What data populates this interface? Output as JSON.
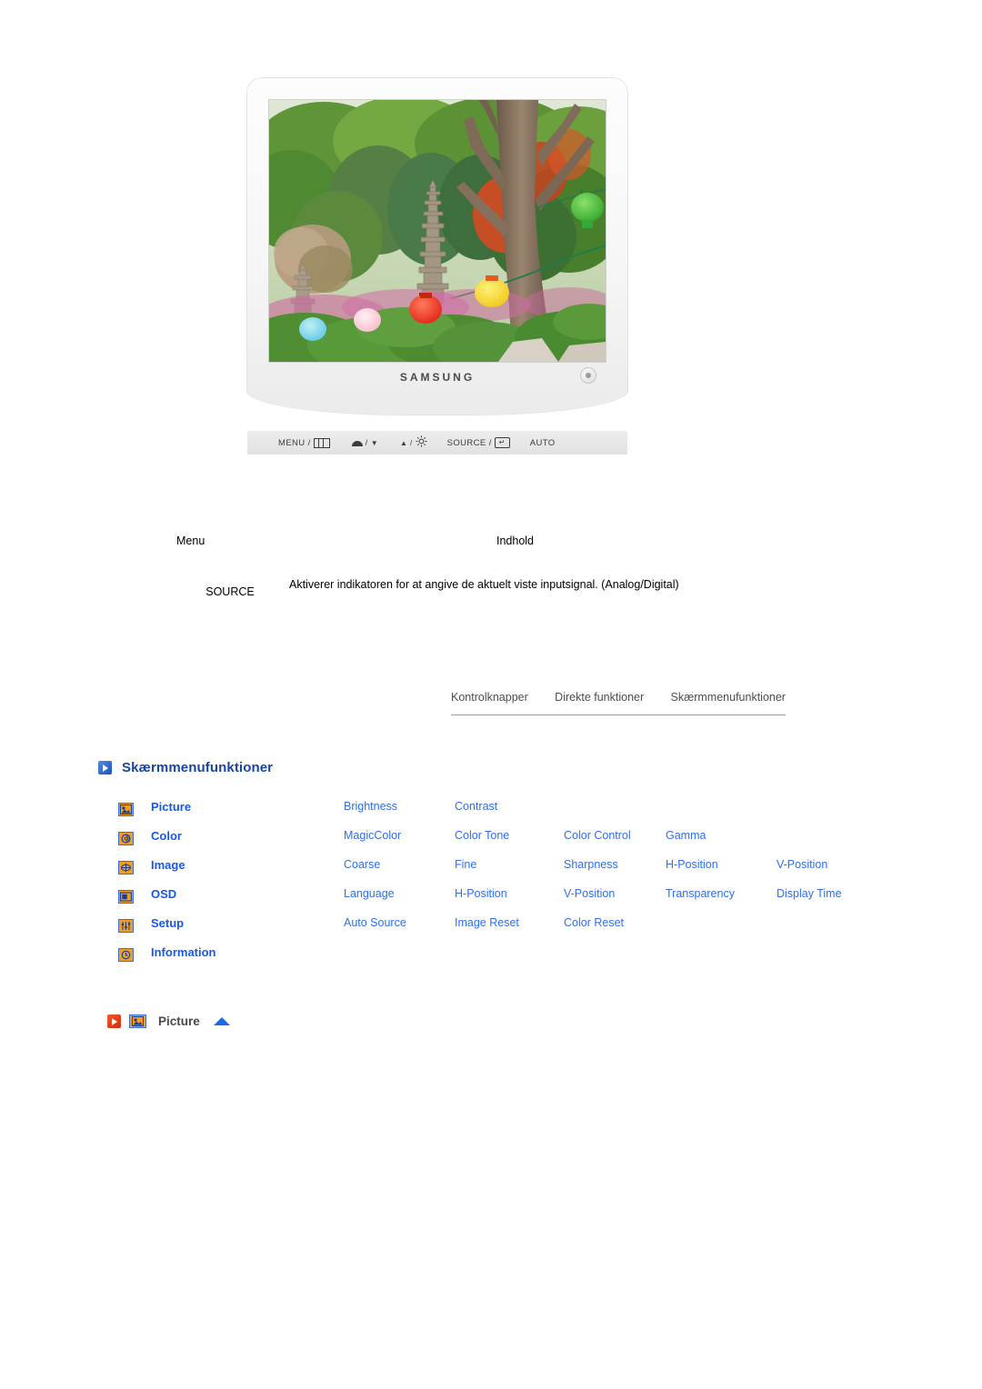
{
  "monitor": {
    "brand": "SAMSUNG",
    "power_button": "power-button",
    "screen_alt": "Korean garden with stone pagoda and paper lanterns"
  },
  "control_bar": {
    "keys": [
      {
        "label": "MENU /",
        "glyph": "menu-grid-icon"
      },
      {
        "label": "/",
        "glyph": "contrast-icon",
        "suffix": "▼"
      },
      {
        "label": "▲ /",
        "glyph": "brightness-sun-icon"
      },
      {
        "label": "SOURCE /",
        "glyph": "enter-key-icon"
      },
      {
        "label": "AUTO",
        "glyph": ""
      }
    ],
    "menu_label": "MENU /",
    "contrast_down_label": "▼",
    "brightness_up_label": "▲ /",
    "source_label": "SOURCE /",
    "auto_label": "AUTO",
    "enter_glyph": "↵"
  },
  "table": {
    "headers": {
      "menu": "Menu",
      "content": "Indhold"
    },
    "rows": [
      {
        "menu": "SOURCE",
        "content": "Aktiverer indikatoren for at angive de aktuelt viste inputsignal. (Analog/Digital)"
      }
    ]
  },
  "tabs": [
    {
      "label": "Kontrolknapper",
      "active": false
    },
    {
      "label": "Direkte funktioner",
      "active": false
    },
    {
      "label": "Skærmmenufunktioner",
      "active": true
    }
  ],
  "section": {
    "title": "Skærmmenufunktioner",
    "icon": "play-square-icon"
  },
  "menu_grid": [
    {
      "icon": "picture-icon",
      "name": "Picture",
      "items": [
        "Brightness",
        "Contrast"
      ]
    },
    {
      "icon": "color-wheel-icon",
      "name": "Color",
      "items": [
        "MagicColor",
        "Color Tone",
        "Color Control",
        "Gamma"
      ]
    },
    {
      "icon": "image-icon",
      "name": "Image",
      "items": [
        "Coarse",
        "Fine",
        "Sharpness",
        "H-Position",
        "V-Position"
      ]
    },
    {
      "icon": "osd-icon",
      "name": "OSD",
      "items": [
        "Language",
        "H-Position",
        "V-Position",
        "Transparency",
        "Display Time"
      ]
    },
    {
      "icon": "setup-icon",
      "name": "Setup",
      "items": [
        "Auto Source",
        "Image Reset",
        "Color Reset"
      ]
    },
    {
      "icon": "information-icon",
      "name": "Information",
      "items": []
    }
  ],
  "bottom": {
    "play_icon": "play-square-red-icon",
    "menu_icon": "picture-icon",
    "label": "Picture",
    "up_arrow": "scroll-up-arrow-icon"
  },
  "colors": {
    "heading_blue": "#17479e",
    "menu_name_blue": "#1558f0",
    "link_blue": "#2f6fe8",
    "icon_orange": "#f39c1f",
    "icon_border_blue": "#3b6fd4",
    "play_red": "#d62a10",
    "arrow_blue": "#1a6ae8",
    "tab_gray": "#4d4d4d"
  }
}
